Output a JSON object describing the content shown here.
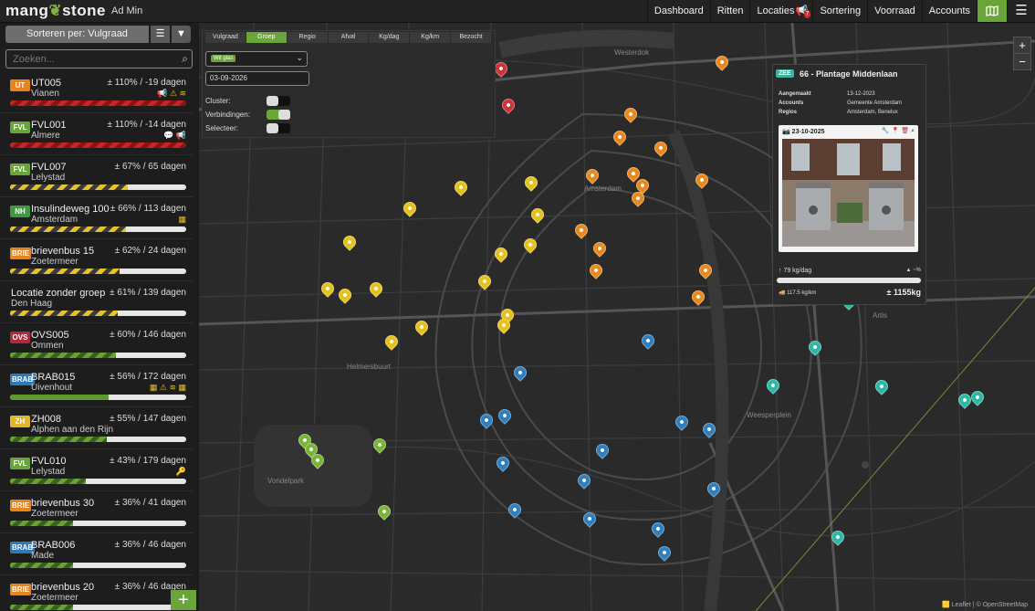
{
  "header": {
    "logo_left": "mang",
    "logo_right": "stone",
    "subtitle": "Ad Min",
    "nav": [
      "Dashboard",
      "Ritten",
      "Locaties",
      "Sortering",
      "Voorraad",
      "Accounts"
    ],
    "locaties_badge": "7"
  },
  "sidebar": {
    "sort_label": "Sorteren per: Vulgraad",
    "search_placeholder": "Zoeken...",
    "locations": [
      {
        "group": "UT",
        "color": "#e9831b",
        "code": "UT005",
        "place": "Vianen",
        "stat": "± 110% / -19 dagen",
        "fill_pct": 100,
        "bar": "red",
        "icons": "📢 ⚠ ≋"
      },
      {
        "group": "FVL",
        "color": "#6aa53a",
        "code": "FVL001",
        "place": "Almere",
        "stat": "± 110% / -14 dagen",
        "fill_pct": 100,
        "bar": "red",
        "icons": "💬 📢"
      },
      {
        "group": "FVL",
        "color": "#6aa53a",
        "code": "FVL007",
        "place": "Lelystad",
        "stat": "± 67% / 65 dagen",
        "fill_pct": 67,
        "bar": "yel",
        "icons": ""
      },
      {
        "group": "NH",
        "color": "#3e9a3e",
        "code": "Insulindeweg 100",
        "place": "Amsterdam",
        "stat": "± 66% / 113 dagen",
        "fill_pct": 66,
        "bar": "yel",
        "icons": "▦"
      },
      {
        "group": "BRIE",
        "color": "#e9831b",
        "code": "brievenbus 15",
        "place": "Zoetermeer",
        "stat": "± 62% / 24 dagen",
        "fill_pct": 62,
        "bar": "yel",
        "icons": ""
      },
      {
        "group": "",
        "color": "",
        "code": "Locatie zonder groep",
        "place": "Den Haag",
        "stat": "± 61% / 139 dagen",
        "fill_pct": 61,
        "bar": "yel",
        "icons": ""
      },
      {
        "group": "OVS",
        "color": "#b5283c",
        "code": "OVS005",
        "place": "Ommen",
        "stat": "± 60% / 146 dagen",
        "fill_pct": 60,
        "bar": "grn",
        "icons": ""
      },
      {
        "group": "BRAB",
        "color": "#2f79b9",
        "code": "BRAB015",
        "place": "Uivenhout",
        "stat": "± 56% / 172 dagen",
        "fill_pct": 56,
        "bar": "grnsolid",
        "icons": "▦ ⚠ ≋ ▦"
      },
      {
        "group": "ZH",
        "color": "#e0b82a",
        "code": "ZH008",
        "place": "Alphen aan den Rijn",
        "stat": "± 55% / 147 dagen",
        "fill_pct": 55,
        "bar": "grn",
        "icons": ""
      },
      {
        "group": "FVL",
        "color": "#6aa53a",
        "code": "FVL010",
        "place": "Lelystad",
        "stat": "± 43% / 179 dagen",
        "fill_pct": 43,
        "bar": "grn",
        "icons": "🔑"
      },
      {
        "group": "BRIE",
        "color": "#e9831b",
        "code": "brievenbus 30",
        "place": "Zoetermeer",
        "stat": "± 36% / 41 dagen",
        "fill_pct": 36,
        "bar": "grn",
        "icons": ""
      },
      {
        "group": "BRAB",
        "color": "#2f79b9",
        "code": "BRAB006",
        "place": "Made",
        "stat": "± 36% / 46 dagen",
        "fill_pct": 36,
        "bar": "grn",
        "icons": ""
      },
      {
        "group": "BRIE",
        "color": "#e9831b",
        "code": "brievenbus 20",
        "place": "Zoetermeer",
        "stat": "± 36% / 46 dagen",
        "fill_pct": 36,
        "bar": "grn",
        "icons": ""
      }
    ]
  },
  "filter_panel": {
    "tabs": [
      "Vulgraad",
      "Groep",
      "Regio",
      "Afval",
      "Kg/dag",
      "Kg/km",
      "Bezocht"
    ],
    "active_tab": "Groep",
    "selected_chip": "Wit glas",
    "date": "03-09-2026",
    "toggles": [
      {
        "label": "Cluster:",
        "on": false
      },
      {
        "label": "Verbindingen:",
        "on": true
      },
      {
        "label": "Selecteer:",
        "on": false
      }
    ]
  },
  "map": {
    "labels": [
      "Westerdok",
      "Amsterdam",
      "Artis",
      "Vondelpark",
      "Helmersbuurt",
      "Weesperplein"
    ],
    "attribution": "🟨 Leaflet | © OpenStreetMap",
    "pin_colors": {
      "orange": "#e8891f",
      "yellow": "#e6c11c",
      "green": "#78b437",
      "blue": "#2f7fbf",
      "teal": "#2fb7a6",
      "red": "#d0313b"
    }
  },
  "popup": {
    "badge": "ZEE",
    "title": "66 - Plantage Middenlaan",
    "rows": [
      {
        "label": "Aangemaakt",
        "value": "13-12-2023"
      },
      {
        "label": "Accounts",
        "value": "Gemeente Amsterdam"
      },
      {
        "label": "Regios",
        "value": "Amsterdam, Benelux"
      }
    ],
    "photo_date": "23-10-2025",
    "kg_per_day": "79 kg/dag",
    "pct": "~%",
    "fill_pct": 100,
    "km_line": "117.5 kg/km",
    "total": "± 1155kg"
  }
}
